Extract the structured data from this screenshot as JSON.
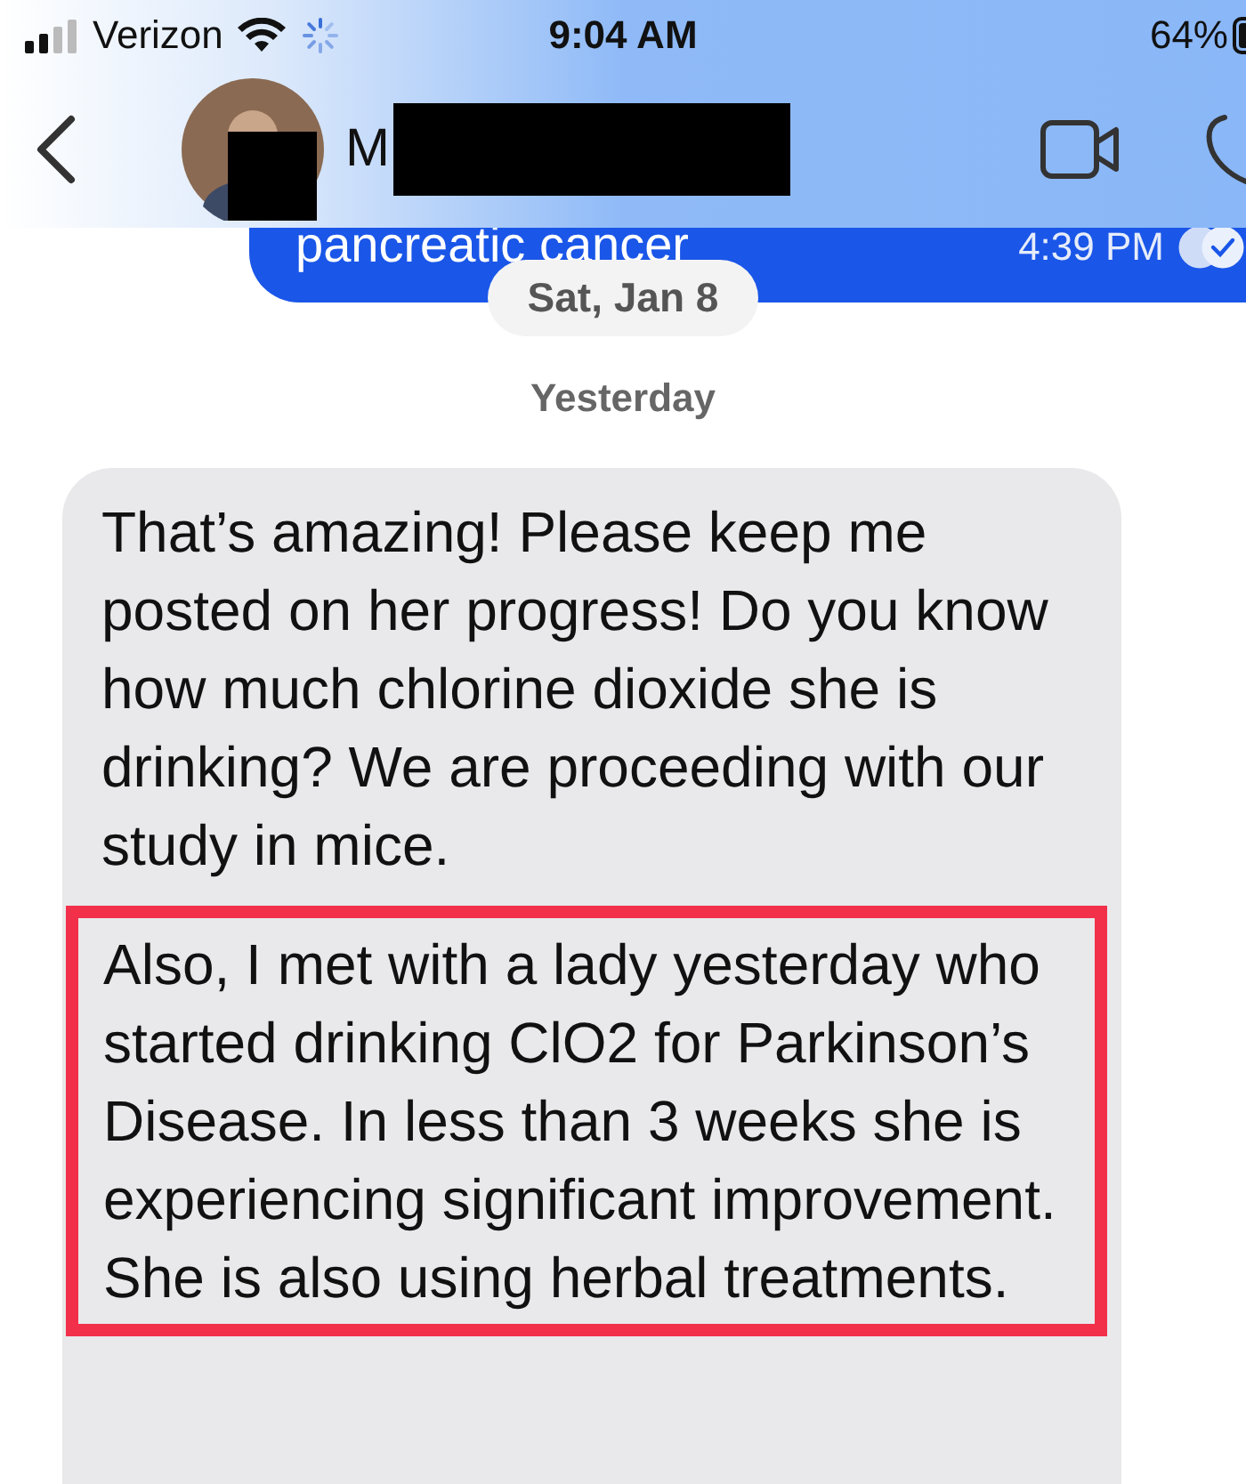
{
  "status_bar": {
    "carrier": "Verizon",
    "time": "9:04 AM",
    "battery": "64%"
  },
  "header": {
    "contact_name": "M",
    "name_redacted": true
  },
  "sent_message": {
    "text": "pancreatic cancer",
    "time": "4:39 PM",
    "read": true
  },
  "date_pill": "Sat, Jan 8",
  "day_label": "Yesterday",
  "received_message": {
    "paragraphs": [
      {
        "text": "That’s amazing! Please keep me posted on her progress! Do you know how much chlorine dioxide she is drinking? We are proceeding with our study in mice.",
        "highlighted": false
      },
      {
        "text": "Also, I met with a lady yesterday who started drinking ClO2 for Parkinson’s Disease. In less than 3 weeks she is experiencing significant improvement. She is also using herbal treatments.",
        "highlighted": true
      }
    ]
  }
}
